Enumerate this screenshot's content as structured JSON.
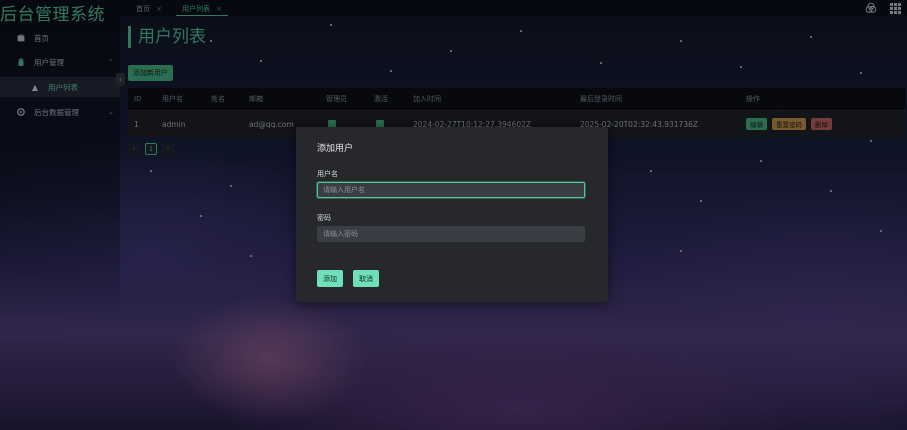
{
  "app": {
    "title": "后台管理系统"
  },
  "sidebar": {
    "items": [
      {
        "label": "首页",
        "icon": "home-icon"
      },
      {
        "label": "用户管理",
        "icon": "android-icon"
      },
      {
        "label": "用户列表",
        "icon": "warning-icon"
      },
      {
        "label": "后台数据管理",
        "icon": "gear-icon"
      }
    ],
    "collapse_glyph": "‹"
  },
  "tabs": [
    {
      "label": "首页",
      "close": "×"
    },
    {
      "label": "用户列表",
      "close": "×"
    }
  ],
  "topbar_icons": [
    "theme-icon",
    "apps-grid-icon"
  ],
  "page": {
    "heading": "用户列表",
    "add_button": "添加新用户"
  },
  "table": {
    "columns": [
      "ID",
      "用户名",
      "姓名",
      "邮箱",
      "管理员",
      "激活",
      "加入时间",
      "最后登录时间",
      "操作"
    ],
    "rows": [
      {
        "id": "1",
        "username": "admin",
        "name": "",
        "email": "ad@qq.com",
        "is_admin": true,
        "is_active": true,
        "joined": "2024-02-27T10:12:27.394602Z",
        "last_login": "2025-02-20T02:32:43.931736Z",
        "actions": [
          "编辑",
          "重置密码",
          "删除"
        ]
      }
    ]
  },
  "pagination": {
    "prev": "‹",
    "current": "1",
    "next": "›"
  },
  "modal": {
    "title": "添加用户",
    "username_label": "用户名",
    "username_placeholder": "请输入用户名",
    "password_label": "密码",
    "password_placeholder": "请输入密码",
    "confirm": "添加",
    "cancel": "取消"
  },
  "colors": {
    "accent": "#4fc995",
    "warning": "#d8a75a",
    "danger": "#d47070",
    "modal_bg": "#27282c"
  }
}
